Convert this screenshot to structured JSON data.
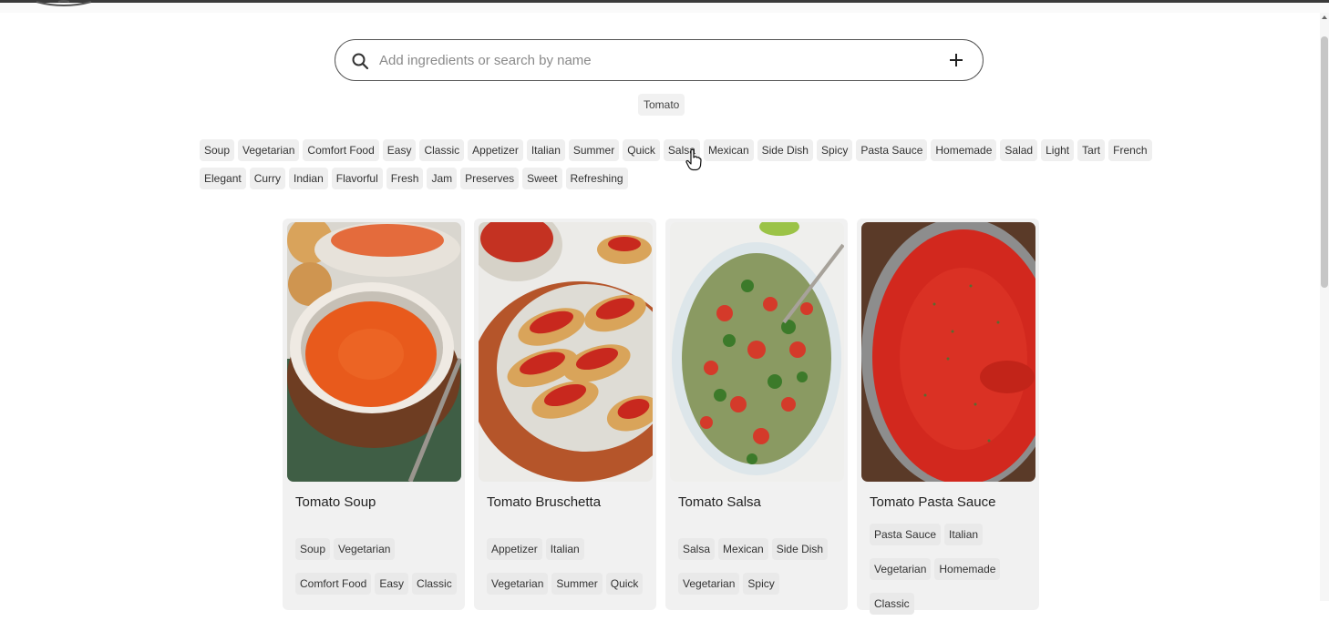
{
  "search": {
    "placeholder": "Add ingredients or search by name",
    "value": ""
  },
  "selected_ingredients": [
    "Tomato"
  ],
  "filter_tags": {
    "row1": [
      "Soup",
      "Vegetarian",
      "Comfort Food",
      "Easy",
      "Classic",
      "Appetizer",
      "Italian",
      "Summer",
      "Quick",
      "Salsa",
      "Mexican",
      "Side Dish",
      "Spicy",
      "Pasta Sauce",
      "Homemade",
      "Salad",
      "Light",
      "Tart",
      "French"
    ],
    "row2": [
      "Elegant",
      "Curry",
      "Indian",
      "Flavorful",
      "Fresh",
      "Jam",
      "Preserves",
      "Sweet",
      "Refreshing"
    ]
  },
  "recipes": [
    {
      "title": "Tomato Soup",
      "image_icon": "tomato-soup-photo",
      "tags_row1": [
        "Soup",
        "Vegetarian"
      ],
      "tags_row2": [
        "Comfort Food",
        "Easy",
        "Classic"
      ],
      "tags_row3": []
    },
    {
      "title": "Tomato Bruschetta",
      "image_icon": "bruschetta-photo",
      "tags_row1": [
        "Appetizer",
        "Italian"
      ],
      "tags_row2": [
        "Vegetarian",
        "Summer",
        "Quick"
      ],
      "tags_row3": []
    },
    {
      "title": "Tomato Salsa",
      "image_icon": "salsa-photo",
      "tags_row1": [
        "Salsa",
        "Mexican",
        "Side Dish"
      ],
      "tags_row2": [
        "Vegetarian",
        "Spicy"
      ],
      "tags_row3": []
    },
    {
      "title": "Tomato Pasta Sauce",
      "image_icon": "pasta-sauce-photo",
      "tags_row1": [
        "Pasta Sauce",
        "Italian"
      ],
      "tags_row2": [
        "Vegetarian",
        "Homemade"
      ],
      "tags_row3": [
        "Classic"
      ]
    }
  ],
  "colors": {
    "chip_bg": "#efefef",
    "card_bg": "#f1f1f1",
    "search_border": "#555555",
    "accent_tomato": "#e8501e"
  }
}
